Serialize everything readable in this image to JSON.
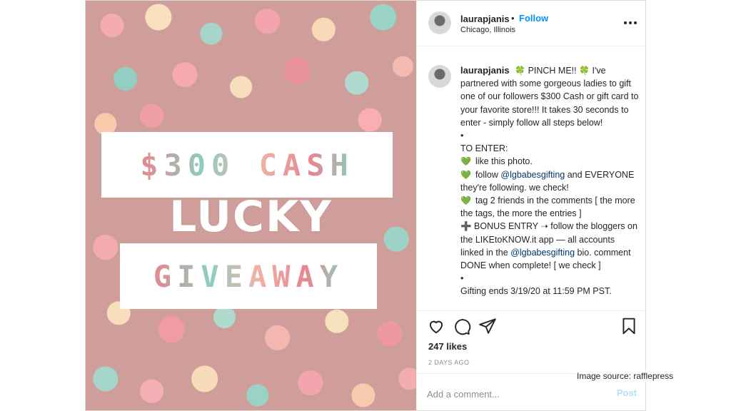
{
  "post": {
    "image": {
      "line1": "$300 CASH",
      "line2": "LUCKY",
      "line3": "GIVEAWAY"
    },
    "header": {
      "username": "laurapjanis",
      "separator": "•",
      "follow_label": "Follow",
      "location": "Chicago, Illinois",
      "more_icon": "ellipsis-icon"
    },
    "caption": {
      "username": "laurapjanis",
      "lines": [
        "PINCH ME!!",
        "I've partnered with some gorgeous ladies to gift one of our followers $300 Cash or gift card to your favorite store!!! It takes 30 seconds to enter - simply follow all steps below!",
        "•",
        "TO ENTER:",
        "like this photo.",
        "follow",
        "@lgbabesgifting",
        "and EVERYONE they're following. we check!",
        "tag 2 friends in the comments [ the more the tags, the more the entries ]",
        "➕ BONUS ENTRY ➝ follow the bloggers on the LIKEtoKNOW.it app — all accounts linked in the",
        "@lgbabesgifting",
        "bio. comment DONE when complete! [ we check ]",
        "•",
        "Gifting ends 3/19/20 at 11:59 PM PST."
      ],
      "clover_icon": "🍀",
      "heart_icon": "💚"
    },
    "actions": {
      "like_icon": "heart-icon",
      "comment_icon": "comment-icon",
      "share_icon": "share-icon",
      "save_icon": "bookmark-icon"
    },
    "likes": "247 likes",
    "time_ago": "2 DAYS AGO",
    "comment": {
      "placeholder": "Add a comment...",
      "post_label": "Post"
    },
    "colors": {
      "follow": "#0095f6",
      "mention": "#00376b",
      "post_disabled": "#b2dffc",
      "muted": "#8e8e8e"
    }
  },
  "source_note": "Image source: rafflepress"
}
